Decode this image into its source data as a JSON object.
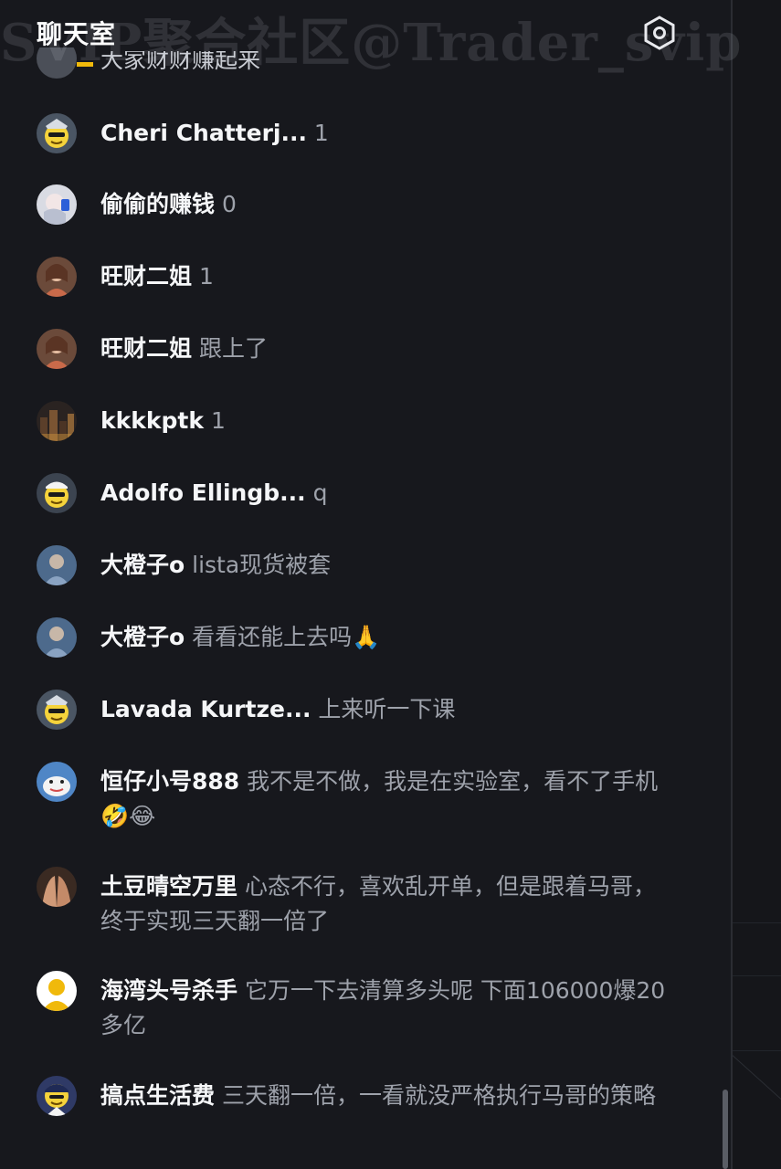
{
  "header": {
    "title": "聊天室",
    "watermark": "SVIP聚合社区@Trader_svip",
    "settings_icon": "hexagon-icon"
  },
  "partial_message_text": "大家财财赚起来",
  "messages": [
    {
      "user": "Cheri Chatterj...",
      "text": "1",
      "avatar_icon": "emoji-police-avatar"
    },
    {
      "user": "偷偷的赚钱",
      "text": "0",
      "avatar_icon": "anime-girl-avatar"
    },
    {
      "user": "旺财二姐",
      "text": "1",
      "avatar_icon": "girl-photo-avatar"
    },
    {
      "user": "旺财二姐",
      "text": "跟上了",
      "avatar_icon": "girl-photo-avatar"
    },
    {
      "user": "kkkkptk",
      "text": "1",
      "avatar_icon": "city-photo-avatar"
    },
    {
      "user": "Adolfo Ellingb...",
      "text": "q",
      "avatar_icon": "emoji-sailor-avatar"
    },
    {
      "user": "大橙子o",
      "text": "lista现货被套",
      "avatar_icon": "blue-photo-avatar"
    },
    {
      "user": "大橙子o",
      "text": "看看还能上去吗🙏",
      "avatar_icon": "blue-photo-avatar"
    },
    {
      "user": "Lavada Kurtze...",
      "text": "上来听一下课",
      "avatar_icon": "emoji-police-avatar"
    },
    {
      "user": "恒仔小号888",
      "text": "我不是不做，我是在实验室，看不了手机🤣😂",
      "avatar_icon": "cartoon-blue-avatar"
    },
    {
      "user": "土豆晴空万里",
      "text": "心态不行，喜欢乱开单，但是跟着马哥，终于实现三天翻一倍了",
      "avatar_icon": "hands-photo-avatar"
    },
    {
      "user": "海湾头号杀手",
      "text": "它万一下去清算多头呢 下面106000爆20多亿",
      "avatar_icon": "yellow-default-avatar"
    },
    {
      "user": "搞点生活费",
      "text": "三天翻一倍，一看就没严格执行马哥的策略",
      "avatar_icon": "emoji-captain-avatar"
    }
  ],
  "colors": {
    "background": "#17181d",
    "username": "#f5f6f8",
    "message_text": "#9ea2ab",
    "accent": "#f0b90b"
  }
}
